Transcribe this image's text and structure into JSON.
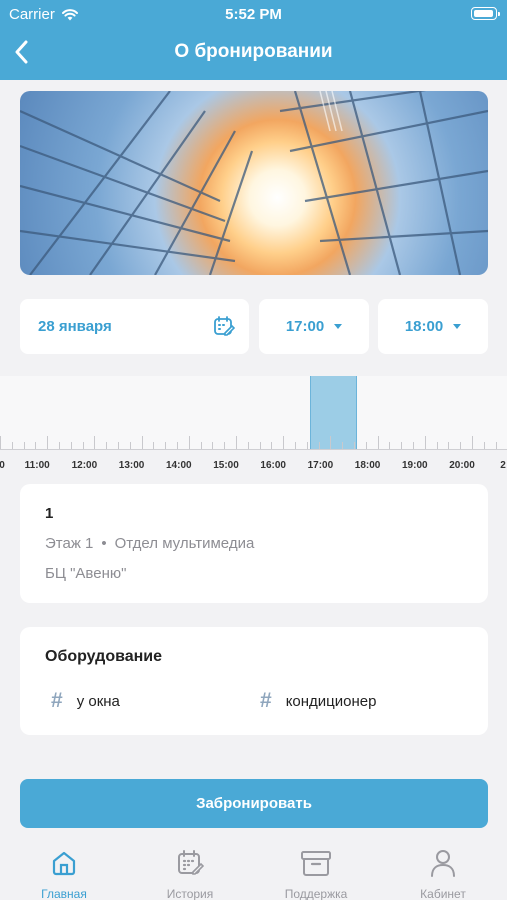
{
  "status_bar": {
    "carrier": "Carrier",
    "time": "5:52 PM"
  },
  "header": {
    "title": "О бронировании"
  },
  "booking": {
    "date": "28 января",
    "start_time": "17:00",
    "end_time": "18:00"
  },
  "timeline": {
    "labels": [
      "0",
      "11:00",
      "12:00",
      "13:00",
      "14:00",
      "15:00",
      "16:00",
      "17:00",
      "18:00",
      "19:00",
      "20:00",
      "2"
    ],
    "selected_start": "17:00",
    "selected_end": "18:00"
  },
  "room": {
    "number": "1",
    "floor": "Этаж 1",
    "department": "Отдел мультимедиа",
    "building": "БЦ \"Авеню\""
  },
  "equipment": {
    "title": "Оборудование",
    "items": [
      "у окна",
      "кондиционер"
    ]
  },
  "book_button": "Забронировать",
  "tabs": [
    {
      "label": "Главная",
      "icon": "home-icon",
      "active": true
    },
    {
      "label": "История",
      "icon": "calendar-icon",
      "active": false
    },
    {
      "label": "Поддержка",
      "icon": "archive-box-icon",
      "active": false
    },
    {
      "label": "Кабинет",
      "icon": "user-icon",
      "active": false
    }
  ],
  "colors": {
    "accent": "#4aa9d6",
    "background": "#f2f2f4",
    "selection": "#9ccde6"
  }
}
